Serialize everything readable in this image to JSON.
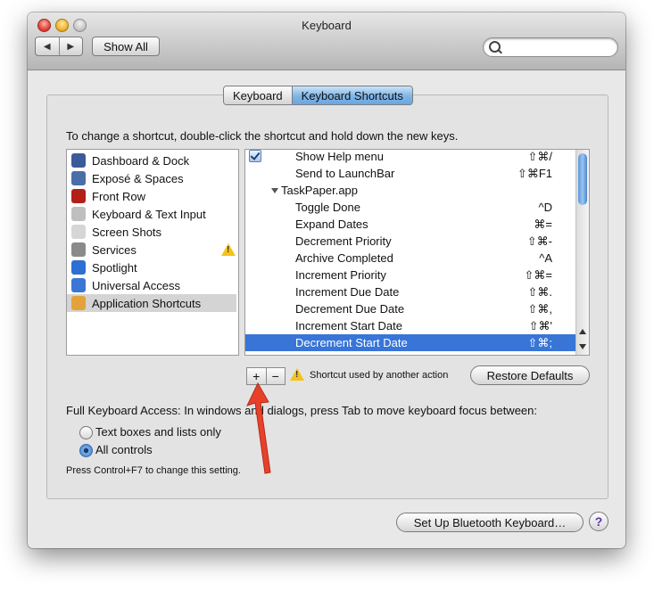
{
  "window": {
    "title": "Keyboard"
  },
  "toolbar": {
    "back_label": "◀",
    "forward_label": "▶",
    "show_all_label": "Show All",
    "search_placeholder": ""
  },
  "tabs": [
    {
      "label": "Keyboard",
      "active": false
    },
    {
      "label": "Keyboard Shortcuts",
      "active": true
    }
  ],
  "instruction": "To change a shortcut, double-click the shortcut and hold down the new keys.",
  "categories": [
    {
      "label": "Dashboard & Dock",
      "icon": "dashboard-dock-icon",
      "color": "#3b5a99"
    },
    {
      "label": "Exposé & Spaces",
      "icon": "expose-spaces-icon",
      "color": "#4a6ea8"
    },
    {
      "label": "Front Row",
      "icon": "front-row-icon",
      "color": "#b3201a"
    },
    {
      "label": "Keyboard & Text Input",
      "icon": "keyboard-icon",
      "color": "#bfbfbf"
    },
    {
      "label": "Screen Shots",
      "icon": "screen-shots-icon",
      "color": "#d6d6d6"
    },
    {
      "label": "Services",
      "icon": "services-gear-icon",
      "color": "#8a8a8a",
      "warning": true
    },
    {
      "label": "Spotlight",
      "icon": "spotlight-icon",
      "color": "#2d6fd3"
    },
    {
      "label": "Universal Access",
      "icon": "universal-access-icon",
      "color": "#3a77d4"
    },
    {
      "label": "Application Shortcuts",
      "icon": "app-shortcuts-icon",
      "color": "#e4a23b",
      "selected": true
    }
  ],
  "shortcuts": [
    {
      "label": "Show Help menu",
      "keys": "⇧⌘/",
      "checkbox": true
    },
    {
      "label": "Send to LaunchBar",
      "keys": "⇧⌘F1"
    },
    {
      "label": "TaskPaper.app",
      "keys": "",
      "group": true
    },
    {
      "label": "Toggle Done",
      "keys": "^D"
    },
    {
      "label": "Expand Dates",
      "keys": "⌘="
    },
    {
      "label": "Decrement Priority",
      "keys": "⇧⌘-"
    },
    {
      "label": "Archive Completed",
      "keys": "^A"
    },
    {
      "label": "Increment Priority",
      "keys": "⇧⌘="
    },
    {
      "label": "Increment Due Date",
      "keys": "⇧⌘."
    },
    {
      "label": "Decrement Due Date",
      "keys": "⇧⌘,"
    },
    {
      "label": "Increment Start Date",
      "keys": "⇧⌘'"
    },
    {
      "label": "Decrement Start Date",
      "keys": "⇧⌘;",
      "selected": true
    }
  ],
  "controls": {
    "plus_label": "+",
    "minus_label": "−",
    "warning_text": "Shortcut used by another action",
    "restore_label": "Restore Defaults"
  },
  "keyboard_access": {
    "text": "Full Keyboard Access: In windows and dialogs, press Tab to move keyboard focus between:",
    "options": [
      {
        "label": "Text boxes and lists only",
        "selected": false
      },
      {
        "label": "All controls",
        "selected": true
      }
    ],
    "hint": "Press Control+F7 to change this setting."
  },
  "bottom": {
    "bluetooth_label": "Set Up Bluetooth Keyboard…",
    "help_label": "?"
  },
  "colors": {
    "selection": "#3875d7",
    "annotation_arrow": "#e8412a"
  }
}
